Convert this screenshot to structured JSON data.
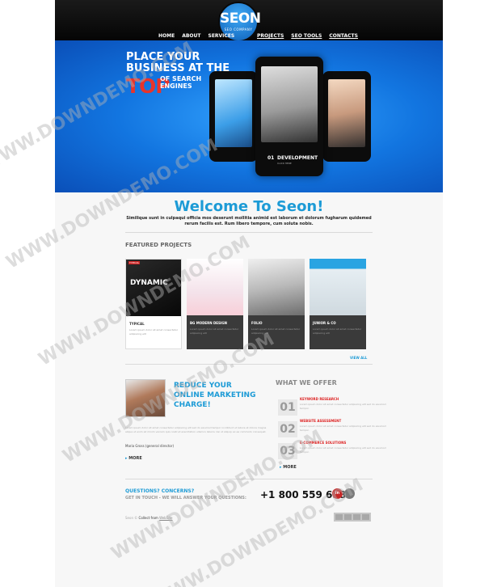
{
  "header": {
    "logo_title": "SEON",
    "logo_subtitle": "SEO COMPANY",
    "nav_left": [
      "HOME",
      "ABOUT",
      "SERVICES"
    ],
    "nav_right": [
      "PROJECTS",
      "SEO TOOLS",
      "CONTACTS"
    ]
  },
  "hero": {
    "line1": "PLACE YOUR",
    "line2": "BUSINESS AT THE",
    "top_word": "TOP",
    "tail1": "OF SEARCH",
    "tail2": "ENGINES",
    "slide_number": "01",
    "slide_label": "DEVELOPMENT",
    "slide_sub": "CLICK HERE"
  },
  "welcome": {
    "title": "Welcome To Seon!",
    "text": "Similique sunt in culpaqui officia mos deserunt mollitia animid est laborum et dolorum fugharum quidemed rerum facilis est. Rum libero tempore, cum soluta nobis."
  },
  "featured": {
    "title": "FEATURED PROJECTS",
    "view_all": "VIEW ALL",
    "projects": [
      {
        "caption": "TYPICAL",
        "desc": "Lorem ipsum dolor sit amet consectetur adipiscing elit",
        "tag": "TYPICAL",
        "overlay": "DYNAMIC"
      },
      {
        "caption": "BG MODERN DESIGN",
        "desc": "Lorem ipsum dolor sit amet consectetur adipiscing elit"
      },
      {
        "caption": "FOLIO",
        "desc": "Lorem ipsum dolor sit amet consectetur adipiscing elit"
      },
      {
        "caption": "JUNIOR & CO",
        "desc": "Lorem ipsum dolor sit amet consectetur adipiscing elit"
      }
    ]
  },
  "reduce": {
    "title": "REDUCE YOUR ONLINE MARKETING CHARGE!",
    "body": "Lorem ipsum dolor sit amet consectetur adipiscing elit sed do eiusmod tempor incididunt ut labore et dolore magna aliqua ut enim ad minim veniam quis nostrud exercitation ullamco laboris nisi ut aliquip ex ea commodo consequat.",
    "author": "Maria Gross (general director)",
    "more": "MORE"
  },
  "offer": {
    "title": "WHAT WE OFFER",
    "items": [
      {
        "num": "01",
        "title": "KEYWORD RESEARCH",
        "desc": "Lorem ipsum dolor sit amet consectetur adipiscing elit sed do eiusmod tempor."
      },
      {
        "num": "02",
        "title": "WEBSITE ASSESSMENT",
        "desc": "Lorem ipsum dolor sit amet consectetur adipiscing elit sed do eiusmod tempor."
      },
      {
        "num": "03",
        "title": "E-COMMERCE SOLUTIONS",
        "desc": "Lorem ipsum dolor sit amet consectetur adipiscing elit sed do eiusmod tempor."
      }
    ],
    "more": "MORE"
  },
  "contact": {
    "question": "QUESTIONS? CONCERNS?",
    "touch": "GET IN TOUCH - WE WILL ANSWER YOUR QUESTIONS:",
    "phone": "+1 800 559 6580",
    "social_1": "in",
    "social_2": ""
  },
  "footer": {
    "prefix": "Seon ©",
    "link1": "Collect from",
    "link2": "WebSite"
  },
  "watermark": "WWW.DOWNDEMO.COM"
}
